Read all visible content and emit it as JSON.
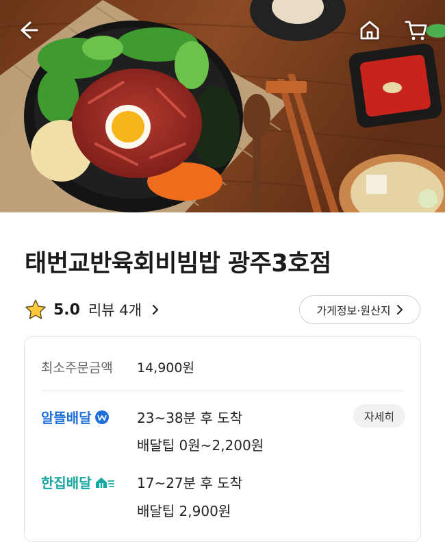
{
  "header": {
    "back_icon": "arrow-left-icon",
    "home_icon": "home-icon",
    "cart_icon": "cart-icon"
  },
  "store": {
    "name": "태번교반육회비빔밥 광주3호점",
    "rating": "5.0",
    "reviews_label": "리뷰 4개",
    "info_button": "가게정보·원산지"
  },
  "order": {
    "min_label": "최소주문금액",
    "min_value": "14,900원"
  },
  "delivery": {
    "altteul": {
      "name": "알뜰배달",
      "time": "23~38분 후 도착",
      "tip": "배달팁 0원~2,200원",
      "detail_button": "자세히"
    },
    "hanjip": {
      "name": "한집배달",
      "time": "17~27분 후 도착",
      "tip": "배달팁 2,900원"
    }
  },
  "colors": {
    "altteul_blue": "#1e6fd9",
    "hanjip_teal": "#17a7a1",
    "star_yellow": "#ffc83d"
  }
}
